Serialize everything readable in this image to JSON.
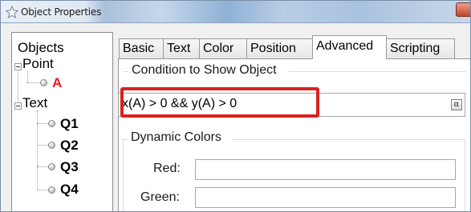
{
  "window": {
    "title": "Object Properties"
  },
  "tree": {
    "header": "Objects",
    "groups": [
      {
        "label": "Point",
        "children": [
          {
            "label": "A",
            "color": "#e8201c"
          }
        ]
      },
      {
        "label": "Text",
        "children": [
          {
            "label": "Q1"
          },
          {
            "label": "Q2"
          },
          {
            "label": "Q3"
          },
          {
            "label": "Q4"
          }
        ]
      }
    ]
  },
  "tabs": [
    {
      "label": "Basic"
    },
    {
      "label": "Text"
    },
    {
      "label": "Color"
    },
    {
      "label": "Position"
    },
    {
      "label": "Advanced",
      "active": true
    },
    {
      "label": "Scripting"
    }
  ],
  "advanced": {
    "condition_title": "Condition to Show Object",
    "condition_value": "x(A) > 0 && y(A) > 0",
    "alpha_symbol": "α",
    "dynamic_colors_title": "Dynamic Colors",
    "red_label": "Red:",
    "red_value": "",
    "green_label": "Green:",
    "green_value": ""
  },
  "highlight_color": "#d9221f"
}
